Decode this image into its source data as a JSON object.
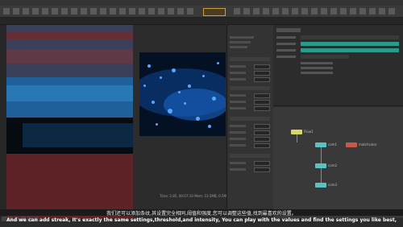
{
  "render_view": {
    "status_text": "Time: 2.85, 00:07:10 Mem: 23.5MB, 0.5MB"
  },
  "node_graph": {
    "nodes": [
      {
        "label": "Flow1"
      },
      {
        "label": "com1"
      },
      {
        "label": "matchcolor"
      },
      {
        "label": "com2"
      },
      {
        "label": "com3"
      }
    ]
  },
  "subtitles": {
    "chinese": "我们还可以添加条纹,其设置完全相同,阈值和强度,您可以调整这些值,找到最喜欢的设置。",
    "english": "And we can add streak, It's exactly the same settings,threshold,and intensity, You can play with the values and find the settings you like best,"
  },
  "colors": {
    "node_yellow": "#d9d66b",
    "node_cyan": "#59c3c3",
    "node_red": "#c8584a",
    "accent_teal": "#2a9a8a",
    "selection_orange": "#c8a040"
  }
}
